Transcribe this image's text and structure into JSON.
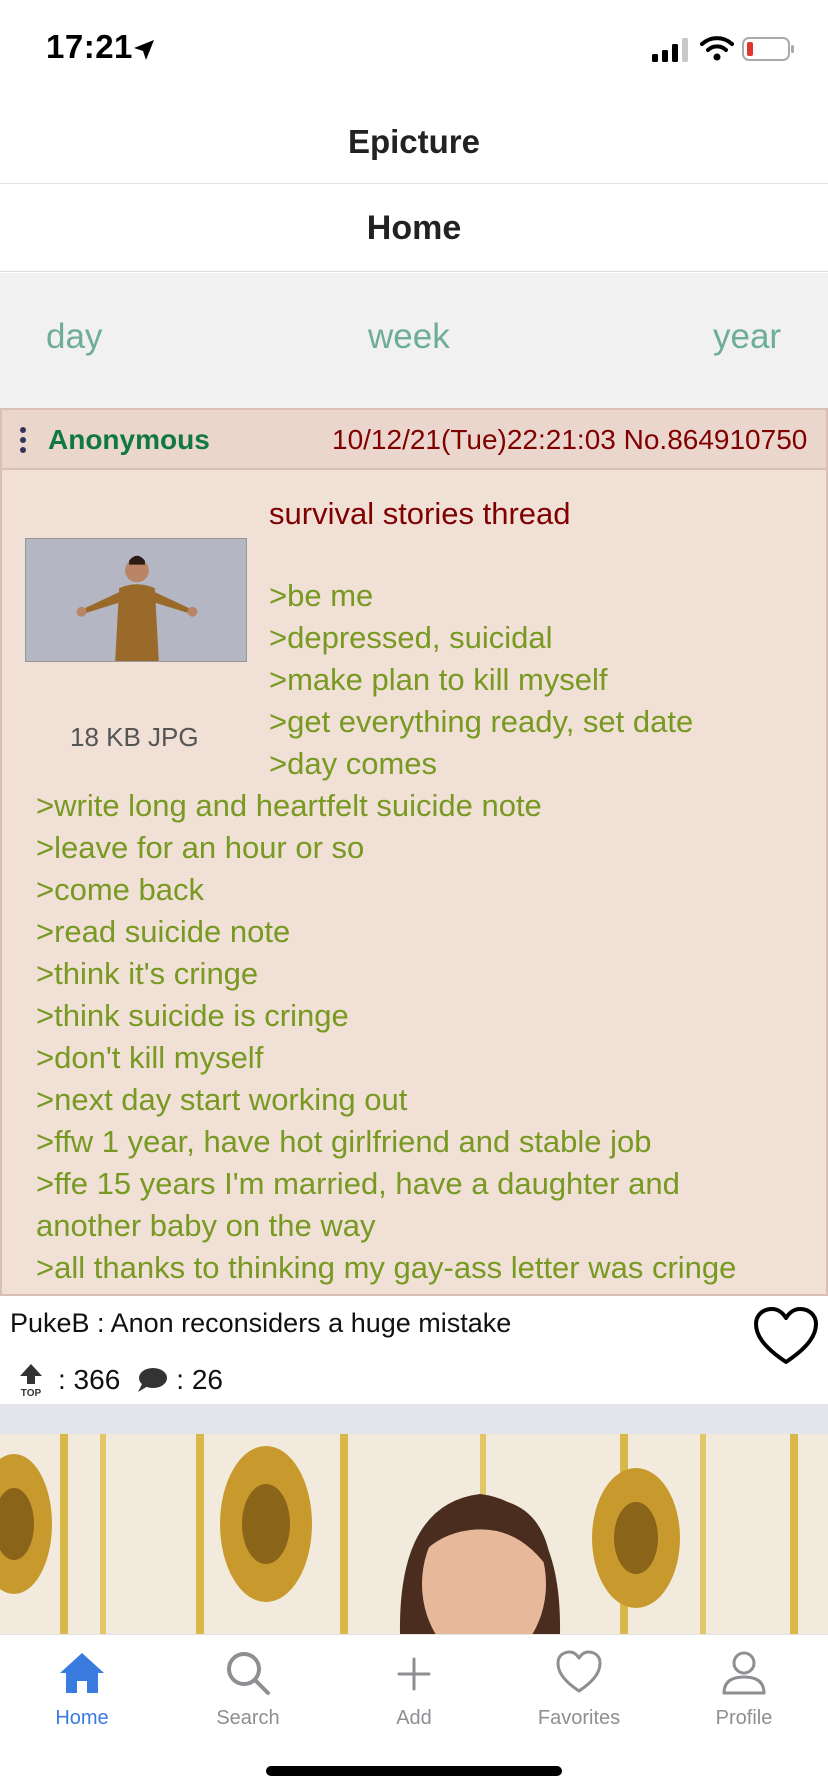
{
  "status_bar": {
    "time": "17:21"
  },
  "header": {
    "app_title": "Epicture",
    "page_title": "Home"
  },
  "period_filter": [
    "day",
    "week",
    "year"
  ],
  "post": {
    "image_text": {
      "author": "Anonymous",
      "meta": "10/12/21(Tue)22:21:03 No.864910750",
      "file_size": "18 KB JPG",
      "subject": "survival stories thread",
      "lines": [
        ">be me",
        ">depressed, suicidal",
        ">make plan to kill myself",
        ">get everything ready, set date",
        ">day comes",
        ">write long and heartfelt suicide note",
        ">leave for an hour or so",
        ">come back",
        ">read suicide note",
        ">think it's cringe",
        ">think suicide is cringe",
        ">don't kill myself",
        ">next day start working out",
        ">ffw 1 year, have hot girlfriend and stable job",
        ">ffe 15 years I'm married, have a daughter and",
        "another baby on the way",
        ">all thanks to thinking my gay-ass letter was cringe"
      ]
    },
    "caption": "PukeB : Anon reconsiders a huge mistake",
    "upvotes": ": 366",
    "comments": ": 26",
    "top_icon_label": "TOP"
  },
  "tabs": [
    {
      "label": "Home",
      "icon": "home-icon",
      "active": true
    },
    {
      "label": "Search",
      "icon": "search-icon",
      "active": false
    },
    {
      "label": "Add",
      "icon": "plus-icon",
      "active": false
    },
    {
      "label": "Favorites",
      "icon": "heart-icon",
      "active": false
    },
    {
      "label": "Profile",
      "icon": "person-icon",
      "active": false
    }
  ],
  "colors": {
    "accent": "#3a7be0",
    "period": "#6fae96",
    "greentext": "#789922",
    "post_bg": "#f0e0d6",
    "author": "#117743",
    "meta": "#800000"
  }
}
